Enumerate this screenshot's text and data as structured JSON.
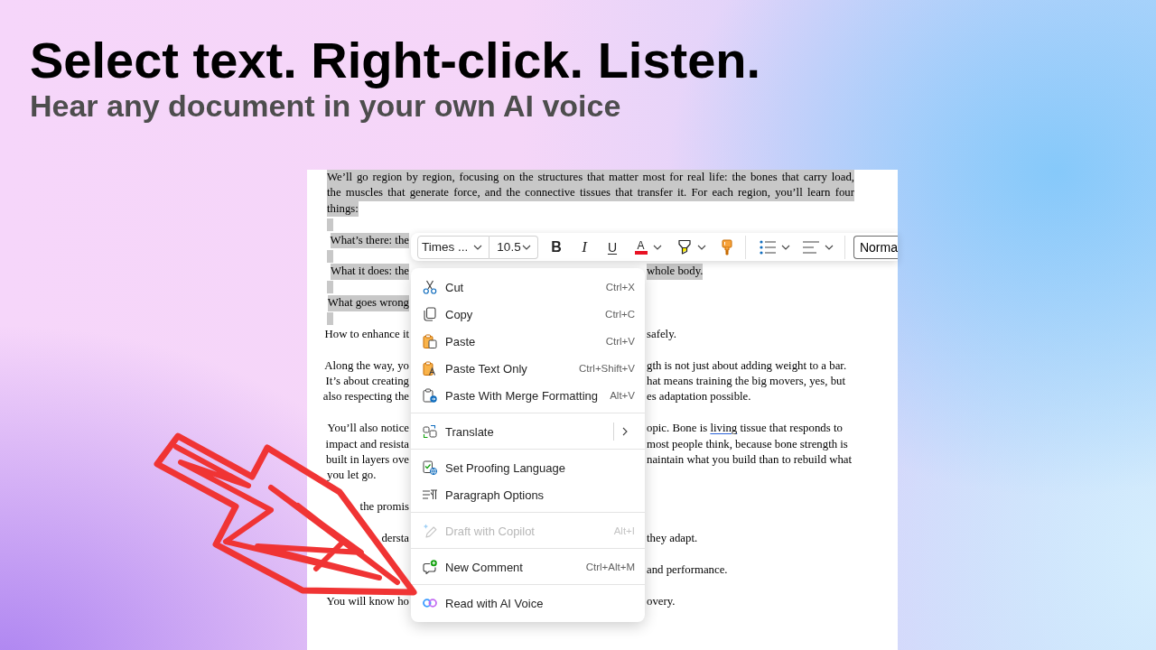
{
  "headline": {
    "title": "Select text. Right-click. Listen.",
    "subtitle": "Hear any document in your own AI voice"
  },
  "document": {
    "paragraphs": [
      {
        "selected": true,
        "lines": [
          {
            "kind": "whole",
            "justified": true,
            "text": "We’ll go region by region, focusing on the structures that matter most for real life: the bones that carry load,"
          },
          {
            "kind": "whole",
            "justified": true,
            "text": "the muscles that generate force, and the connective tissues that transfer it. For each region, you’ll learn four"
          },
          {
            "kind": "whole",
            "justified": false,
            "text": "things:"
          }
        ]
      },
      {
        "selected": true
      },
      {
        "selected": true,
        "lines": [
          {
            "kind": "split",
            "left": "What’s there: the"
          }
        ]
      },
      {
        "selected": true
      },
      {
        "selected": true,
        "lines": [
          {
            "kind": "split",
            "left": "What it does: the",
            "right": "whole body."
          }
        ]
      },
      {
        "selected": true
      },
      {
        "selected": true,
        "lines": [
          {
            "kind": "split",
            "left": "What goes wrong"
          }
        ]
      },
      {
        "selected": true
      },
      {
        "selected": false,
        "lines": [
          {
            "kind": "split",
            "left": "How to enhance it",
            "right": "safely."
          }
        ]
      },
      {
        "selected": false
      },
      {
        "selected": false,
        "lines": [
          {
            "kind": "split",
            "left": "Along the way, yo",
            "right": "gth is not just about adding weight to a bar."
          },
          {
            "kind": "split",
            "left": "It’s about creating",
            "right": "hat means training the big movers, yes, but"
          },
          {
            "kind": "split",
            "left": "also respecting the",
            "right": "es adaptation possible."
          }
        ]
      },
      {
        "selected": false
      },
      {
        "selected": false,
        "lines": [
          {
            "kind": "split",
            "left": "You’ll also notice",
            "right": [
              {
                "kind": "text",
                "text": "opic. Bone is "
              },
              {
                "kind": "link",
                "text": "living"
              },
              {
                "kind": "text",
                "text": " tissue that responds to"
              }
            ]
          },
          {
            "kind": "split",
            "left": "impact and resista",
            "right": "most people think, because bone strength is"
          },
          {
            "kind": "split",
            "left": "built in layers ove",
            "right": "naintain what you build than to rebuild what"
          },
          {
            "kind": "whole",
            "justified": false,
            "text": "you let go."
          }
        ]
      },
      {
        "selected": false
      },
      {
        "selected": false,
        "lines": [
          {
            "kind": "split",
            "left": "the promis"
          }
        ]
      },
      {
        "selected": false
      },
      {
        "selected": false,
        "lines": [
          {
            "kind": "split",
            "left": "dersta",
            "right": "they adapt."
          }
        ]
      },
      {
        "selected": false
      },
      {
        "selected": false,
        "lines": [
          {
            "kind": "split",
            "right": "and performance."
          }
        ]
      },
      {
        "selected": false
      },
      {
        "selected": false,
        "lines": [
          {
            "kind": "split",
            "left": "You will know ho",
            "right": "overy."
          }
        ]
      }
    ]
  },
  "toolbar": {
    "font": {
      "value": "Times ..."
    },
    "size": {
      "value": "10.5"
    },
    "format_buttons": [
      {
        "kind": "bold",
        "glyph": "B",
        "has_menu": false
      },
      {
        "kind": "italic",
        "glyph": "I",
        "has_menu": false
      },
      {
        "kind": "underline",
        "glyph": "U",
        "has_menu": false
      },
      {
        "kind": "font_color",
        "glyph": "A",
        "color": "#e81123",
        "has_menu": true
      },
      {
        "kind": "highlight",
        "color": "#fff100",
        "has_menu": true
      },
      {
        "kind": "format_painter",
        "has_menu": false
      }
    ],
    "paragraph_buttons": [
      {
        "kind": "bullets",
        "has_menu": true
      },
      {
        "kind": "align",
        "has_menu": true
      }
    ],
    "style": {
      "value": "Norma"
    }
  },
  "context_menu": {
    "sections": [
      {
        "items": [
          {
            "kind": "command",
            "label": "Cut",
            "shortcut": "Ctrl+X",
            "disabled": false
          },
          {
            "kind": "command",
            "label": "Copy",
            "shortcut": "Ctrl+C",
            "disabled": false
          },
          {
            "kind": "command",
            "label": "Paste",
            "shortcut": "Ctrl+V",
            "disabled": false
          },
          {
            "kind": "command",
            "label": "Paste Text Only",
            "shortcut": "Ctrl+Shift+V",
            "disabled": false
          },
          {
            "kind": "command",
            "label": "Paste With Merge Formatting",
            "shortcut": "Alt+V",
            "disabled": false
          }
        ]
      },
      {
        "items": [
          {
            "kind": "submenu",
            "label": "Translate",
            "disabled": false
          }
        ]
      },
      {
        "items": [
          {
            "kind": "command",
            "label": "Set Proofing Language",
            "disabled": false
          },
          {
            "kind": "command",
            "label": "Paragraph Options",
            "disabled": false
          }
        ]
      },
      {
        "items": [
          {
            "kind": "command",
            "label": "Draft with Copilot",
            "shortcut": "Alt+I",
            "disabled": true
          }
        ]
      },
      {
        "items": [
          {
            "kind": "command",
            "label": "New Comment",
            "shortcut": "Ctrl+Alt+M",
            "disabled": false
          }
        ]
      },
      {
        "items": [
          {
            "kind": "command",
            "label": "Read with AI Voice",
            "disabled": false
          }
        ]
      }
    ]
  }
}
